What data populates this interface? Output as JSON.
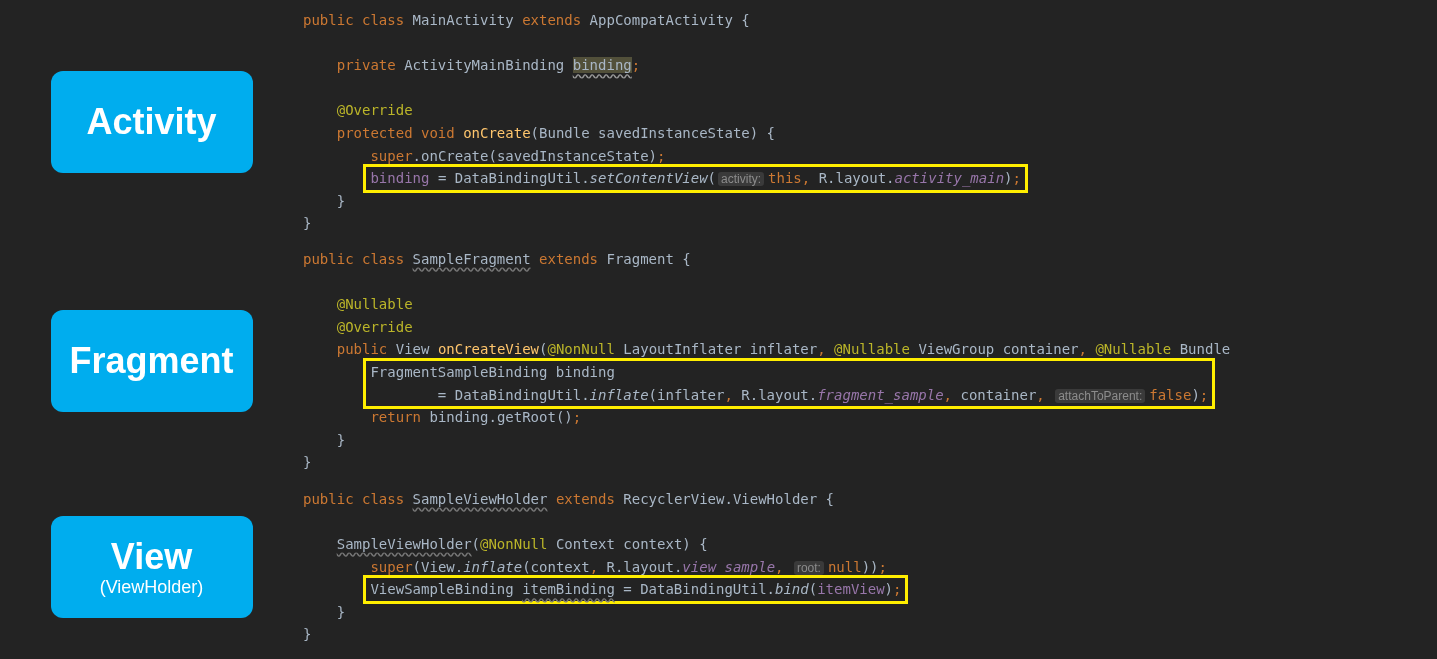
{
  "sections": [
    {
      "label": {
        "title": "Activity"
      },
      "code": [
        {
          "kind": "line",
          "tokens": [
            {
              "kind": "keyword",
              "text": "public class "
            },
            {
              "kind": "plain",
              "text": "MainActivity "
            },
            {
              "kind": "keyword",
              "text": "extends "
            },
            {
              "kind": "plain",
              "text": "AppCompatActivity {"
            }
          ]
        },
        {
          "kind": "blank"
        },
        {
          "kind": "line",
          "tokens": [
            {
              "kind": "keyword",
              "text": "    private "
            },
            {
              "kind": "plain",
              "text": "ActivityMainBinding "
            },
            {
              "kind": "highlight",
              "text": "binding"
            },
            {
              "kind": "keyword",
              "text": ";"
            }
          ]
        },
        {
          "kind": "blank"
        },
        {
          "kind": "line",
          "tokens": [
            {
              "kind": "annotation",
              "text": "    @Override"
            }
          ]
        },
        {
          "kind": "line",
          "tokens": [
            {
              "kind": "keyword",
              "text": "    protected void "
            },
            {
              "kind": "method",
              "text": "onCreate"
            },
            {
              "kind": "plain",
              "text": "(Bundle savedInstanceState) {"
            }
          ]
        },
        {
          "kind": "line",
          "tokens": [
            {
              "kind": "keyword",
              "text": "        super"
            },
            {
              "kind": "plain",
              "text": ".onCreate(savedInstanceState)"
            },
            {
              "kind": "keyword",
              "text": ";"
            }
          ]
        },
        {
          "kind": "box",
          "lines": [
            {
              "tokens": [
                {
                  "kind": "field",
                  "text": "binding"
                },
                {
                  "kind": "plain",
                  "text": " = DataBindingUtil."
                },
                {
                  "kind": "static",
                  "text": "setContentView"
                },
                {
                  "kind": "plain",
                  "text": "("
                },
                {
                  "kind": "hint",
                  "text": "activity:"
                },
                {
                  "kind": "keyword",
                  "text": "this, "
                },
                {
                  "kind": "plain",
                  "text": "R.layout."
                },
                {
                  "kind": "constant",
                  "text": "activity_main"
                },
                {
                  "kind": "plain",
                  "text": ")"
                },
                {
                  "kind": "keyword",
                  "text": ";"
                }
              ]
            }
          ]
        },
        {
          "kind": "line",
          "tokens": [
            {
              "kind": "plain",
              "text": "    }"
            }
          ]
        },
        {
          "kind": "line",
          "tokens": [
            {
              "kind": "plain",
              "text": "}"
            }
          ]
        }
      ]
    },
    {
      "label": {
        "title": "Fragment"
      },
      "code": [
        {
          "kind": "line",
          "tokens": [
            {
              "kind": "keyword",
              "text": "public class "
            },
            {
              "kind": "warning",
              "text": "SampleFragment"
            },
            {
              "kind": "keyword",
              "text": " extends "
            },
            {
              "kind": "plain",
              "text": "Fragment {"
            }
          ]
        },
        {
          "kind": "blank"
        },
        {
          "kind": "line",
          "tokens": [
            {
              "kind": "annotation",
              "text": "    @Nullable"
            }
          ]
        },
        {
          "kind": "line",
          "tokens": [
            {
              "kind": "annotation",
              "text": "    @Override"
            }
          ]
        },
        {
          "kind": "line",
          "tokens": [
            {
              "kind": "keyword",
              "text": "    public "
            },
            {
              "kind": "plain",
              "text": "View "
            },
            {
              "kind": "method",
              "text": "onCreateView"
            },
            {
              "kind": "plain",
              "text": "("
            },
            {
              "kind": "annotation",
              "text": "@NonNull "
            },
            {
              "kind": "plain",
              "text": "LayoutInflater inflater"
            },
            {
              "kind": "keyword",
              "text": ", "
            },
            {
              "kind": "annotation",
              "text": "@Nullable "
            },
            {
              "kind": "plain",
              "text": "ViewGroup container"
            },
            {
              "kind": "keyword",
              "text": ", "
            },
            {
              "kind": "annotation",
              "text": "@Nullable "
            },
            {
              "kind": "plain",
              "text": "Bundle"
            }
          ]
        },
        {
          "kind": "box",
          "lines": [
            {
              "tokens": [
                {
                  "kind": "plain",
                  "text": "FragmentSampleBinding binding"
                }
              ]
            },
            {
              "tokens": [
                {
                  "kind": "plain",
                  "text": "        = DataBindingUtil."
                },
                {
                  "kind": "static",
                  "text": "inflate"
                },
                {
                  "kind": "plain",
                  "text": "(inflater"
                },
                {
                  "kind": "keyword",
                  "text": ", "
                },
                {
                  "kind": "plain",
                  "text": "R.layout."
                },
                {
                  "kind": "constant",
                  "text": "fragment_sample"
                },
                {
                  "kind": "keyword",
                  "text": ", "
                },
                {
                  "kind": "plain",
                  "text": "container"
                },
                {
                  "kind": "keyword",
                  "text": ", "
                },
                {
                  "kind": "hint",
                  "text": "attachToParent:"
                },
                {
                  "kind": "keyword",
                  "text": "false"
                },
                {
                  "kind": "plain",
                  "text": ")"
                },
                {
                  "kind": "keyword",
                  "text": ";"
                }
              ]
            }
          ]
        },
        {
          "kind": "line",
          "tokens": [
            {
              "kind": "keyword",
              "text": "        return "
            },
            {
              "kind": "plain",
              "text": "binding.getRoot()"
            },
            {
              "kind": "keyword",
              "text": ";"
            }
          ]
        },
        {
          "kind": "line",
          "tokens": [
            {
              "kind": "plain",
              "text": "    }"
            }
          ]
        },
        {
          "kind": "line",
          "tokens": [
            {
              "kind": "plain",
              "text": "}"
            }
          ]
        }
      ]
    },
    {
      "label": {
        "title": "View",
        "subtitle": "(ViewHolder)"
      },
      "code": [
        {
          "kind": "line",
          "tokens": [
            {
              "kind": "keyword",
              "text": "public class "
            },
            {
              "kind": "warning",
              "text": "SampleViewHolder"
            },
            {
              "kind": "keyword",
              "text": " extends "
            },
            {
              "kind": "plain",
              "text": "RecyclerView.ViewHolder {"
            }
          ]
        },
        {
          "kind": "blank"
        },
        {
          "kind": "line",
          "tokens": [
            {
              "kind": "warning",
              "text": "    SampleViewHolder"
            },
            {
              "kind": "plain",
              "text": "("
            },
            {
              "kind": "annotation",
              "text": "@NonNull "
            },
            {
              "kind": "plain",
              "text": "Context context) {"
            }
          ]
        },
        {
          "kind": "line",
          "tokens": [
            {
              "kind": "keyword",
              "text": "        super"
            },
            {
              "kind": "plain",
              "text": "(View."
            },
            {
              "kind": "static",
              "text": "inflate"
            },
            {
              "kind": "plain",
              "text": "(context"
            },
            {
              "kind": "keyword",
              "text": ", "
            },
            {
              "kind": "plain",
              "text": "R.layout."
            },
            {
              "kind": "constant",
              "text": "view_sample"
            },
            {
              "kind": "keyword",
              "text": ", "
            },
            {
              "kind": "hint",
              "text": "root:"
            },
            {
              "kind": "keyword",
              "text": "null"
            },
            {
              "kind": "plain",
              "text": "))"
            },
            {
              "kind": "keyword",
              "text": ";"
            }
          ]
        },
        {
          "kind": "box",
          "lines": [
            {
              "tokens": [
                {
                  "kind": "plain",
                  "text": "ViewSampleBinding "
                },
                {
                  "kind": "warning",
                  "text": "itemBinding"
                },
                {
                  "kind": "plain",
                  "text": " = DataBindingUtil."
                },
                {
                  "kind": "static",
                  "text": "bind"
                },
                {
                  "kind": "plain",
                  "text": "("
                },
                {
                  "kind": "field",
                  "text": "itemView"
                },
                {
                  "kind": "plain",
                  "text": ")"
                },
                {
                  "kind": "keyword",
                  "text": ";"
                }
              ]
            }
          ]
        },
        {
          "kind": "line",
          "tokens": [
            {
              "kind": "plain",
              "text": "    }"
            }
          ]
        },
        {
          "kind": "line",
          "tokens": [
            {
              "kind": "plain",
              "text": "}"
            }
          ]
        }
      ]
    }
  ]
}
